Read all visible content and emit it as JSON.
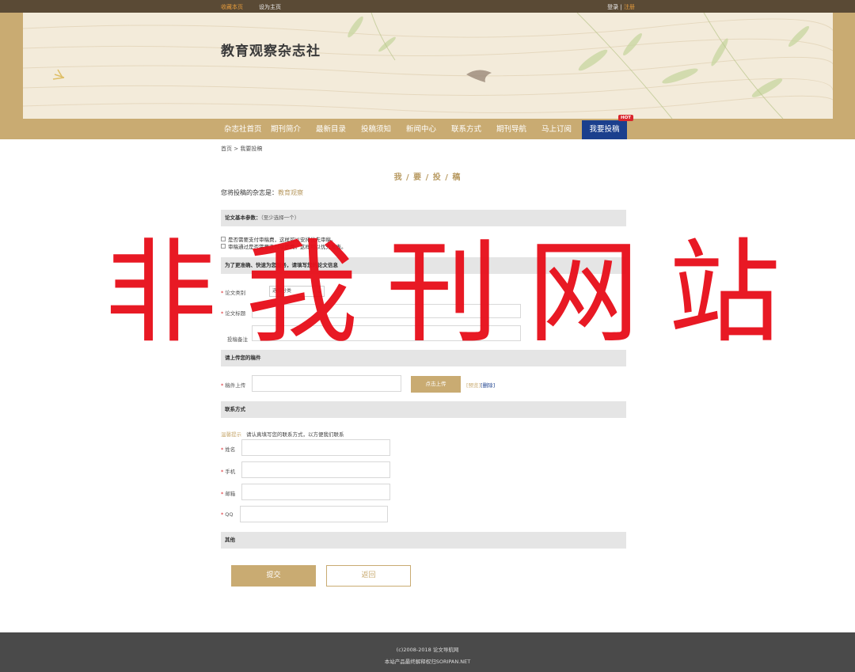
{
  "topbar": {
    "favorite": "收藏本页",
    "set_home": "设为主页",
    "login": "登录",
    "separator": "|",
    "register": "注册"
  },
  "site": {
    "title": "教育观察杂志社"
  },
  "nav": {
    "items": [
      {
        "label": "杂志社首页"
      },
      {
        "label": "期刊简介"
      },
      {
        "label": "最新目录"
      },
      {
        "label": "投稿须知"
      },
      {
        "label": "新闻中心"
      },
      {
        "label": "联系方式"
      },
      {
        "label": "期刊导航"
      },
      {
        "label": "马上订阅"
      },
      {
        "label": "我要投稿",
        "active": true,
        "badge": "HOT"
      }
    ]
  },
  "breadcrumb": {
    "home": "首页",
    "sep": ">",
    "current": "我要投稿"
  },
  "page": {
    "heading": "我 / 要 / 投 / 稿"
  },
  "journal": {
    "prefix": "您将投稿的杂志是：",
    "name": "教育观察"
  },
  "sections": {
    "basic": {
      "title": "论文基本参数：",
      "note": "（至少选择一个）"
    },
    "service": {
      "title": "为了更准确、快速为您服务，请填写您的论文信息"
    },
    "upload": {
      "title": "请上传您的稿件"
    },
    "contact": {
      "title": "联系方式"
    },
    "other": {
      "title": "其他"
    }
  },
  "checkboxes": [
    {
      "label": "是否需要支付审稿费，这样可以安排优先审稿。"
    },
    {
      "label": "审稿通过是否需要支付版面费，这样可以优先发表。"
    }
  ],
  "fields": {
    "category": {
      "label": "论文类别",
      "value": "选择分类"
    },
    "title": {
      "label": "论文标题"
    },
    "remark": {
      "label": "投稿备注"
    },
    "file": {
      "label": "稿件上传"
    },
    "name": {
      "label": "姓名"
    },
    "phone": {
      "label": "手机"
    },
    "email": {
      "label": "邮箱"
    },
    "qq": {
      "label": "QQ"
    }
  },
  "upload": {
    "button": "点击上传",
    "preview": "[预览]",
    "delete": "[删除]"
  },
  "contact_tip": {
    "label": "温馨提示",
    "text": "请认真填写您的联系方式，以方便我们联系"
  },
  "actions": {
    "submit": "提交",
    "back": "返回"
  },
  "watermark": {
    "text": "非我刊网站"
  },
  "footer": {
    "line1": "(c)2008-2018 论文导航网",
    "line2": "本站产品最终解释权归SORIPAN.NET"
  },
  "colors": {
    "accent": "#c9ab72",
    "nav_active": "#1b3f8d",
    "watermark": "#e8101c",
    "footer_bg": "#4a4a4a"
  }
}
